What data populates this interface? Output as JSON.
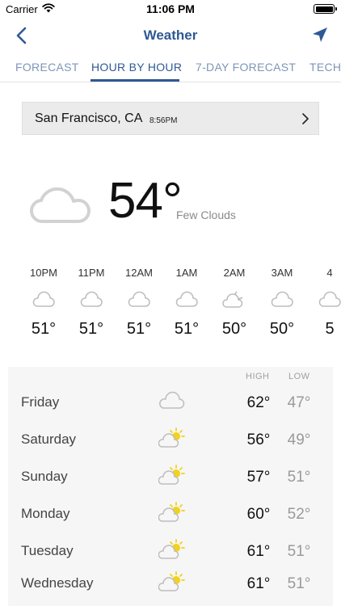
{
  "status_bar": {
    "carrier": "Carrier",
    "time": "11:06 PM"
  },
  "nav": {
    "title": "Weather"
  },
  "tabs": [
    {
      "label": "FORECAST"
    },
    {
      "label": "HOUR BY HOUR"
    },
    {
      "label": "7-DAY FORECAST"
    },
    {
      "label": "TECH"
    }
  ],
  "location": {
    "city": "San Francisco, CA",
    "time": "8:56PM"
  },
  "current": {
    "temp": "54°",
    "description": "Few Clouds"
  },
  "hourly": [
    {
      "time": "10PM",
      "temp": "51°",
      "icon": "cloud-icon"
    },
    {
      "time": "11PM",
      "temp": "51°",
      "icon": "cloud-icon"
    },
    {
      "time": "12AM",
      "temp": "51°",
      "icon": "cloud-icon"
    },
    {
      "time": "1AM",
      "temp": "51°",
      "icon": "cloud-icon"
    },
    {
      "time": "2AM",
      "temp": "50°",
      "icon": "cloud-moon-icon"
    },
    {
      "time": "3AM",
      "temp": "50°",
      "icon": "cloud-icon"
    },
    {
      "time": "4",
      "temp": "5",
      "icon": "cloud-icon"
    }
  ],
  "daily": {
    "high_label": "HIGH",
    "low_label": "LOW",
    "days": [
      {
        "name": "Friday",
        "high": "62°",
        "low": "47°",
        "icon": "cloud-icon"
      },
      {
        "name": "Saturday",
        "high": "56°",
        "low": "49°",
        "icon": "partly-sunny-icon"
      },
      {
        "name": "Sunday",
        "high": "57°",
        "low": "51°",
        "icon": "partly-sunny-icon"
      },
      {
        "name": "Monday",
        "high": "60°",
        "low": "52°",
        "icon": "partly-sunny-icon"
      },
      {
        "name": "Tuesday",
        "high": "61°",
        "low": "51°",
        "icon": "partly-sunny-icon"
      },
      {
        "name": "Wednesday",
        "high": "61°",
        "low": "51°",
        "icon": "partly-sunny-icon"
      }
    ]
  },
  "colors": {
    "accent": "#2f5994",
    "tab_inactive": "#7d96b8",
    "sun": "#f2d21b"
  }
}
